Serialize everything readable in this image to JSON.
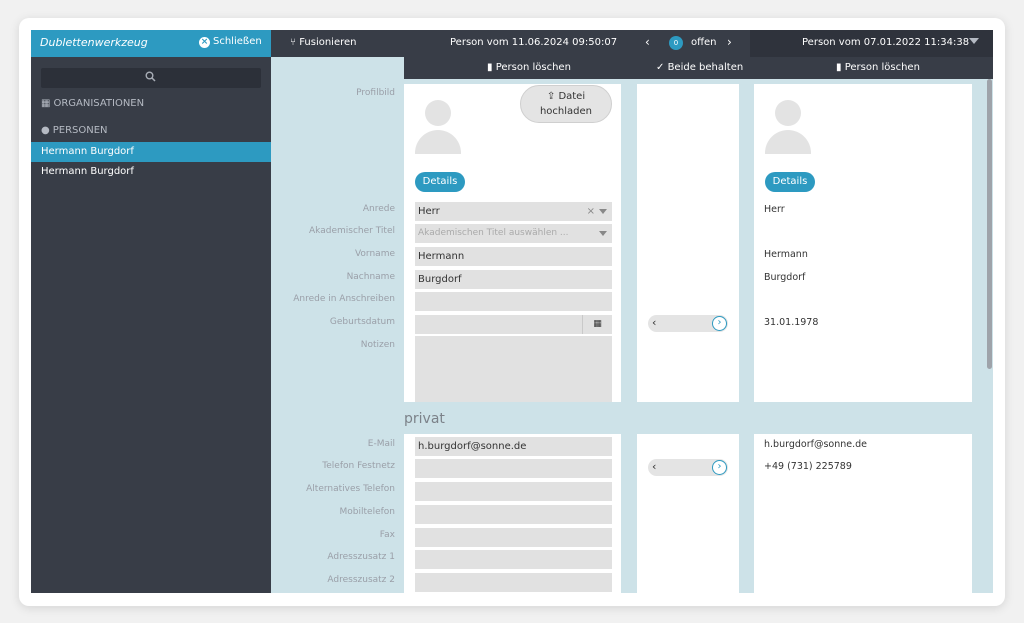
{
  "sidebar": {
    "title": "Dublettenwerkzeug",
    "close_label": "Schließen",
    "search_icon": "search-icon",
    "cat_orgs": "ORGANISATIONEN",
    "cat_persons": "PERSONEN",
    "items": [
      {
        "label": "Hermann Burgdorf",
        "active": true
      },
      {
        "label": "Hermann Burgdorf",
        "active": false
      }
    ]
  },
  "topbar": {
    "merge_label": "Fusionieren",
    "left_record": "Person vom 11.06.2024 09:50:07",
    "open_count": "0",
    "open_label": "offen",
    "right_record": "Person vom 07.01.2022 11:34:38"
  },
  "actions": {
    "delete_left": "Person löschen",
    "keep_both": "Beide behalten",
    "delete_right": "Person löschen"
  },
  "labels": {
    "profilbild": "Profilbild",
    "anrede": "Anrede",
    "titel": "Akademischer Titel",
    "vorname": "Vorname",
    "nachname": "Nachname",
    "anrede_anschreiben": "Anrede in Anschreiben",
    "geburtsdatum": "Geburtsdatum",
    "notizen": "Notizen",
    "privat": "privat",
    "email": "E-Mail",
    "telefon": "Telefon Festnetz",
    "alt_telefon": "Alternatives Telefon",
    "mobil": "Mobiltelefon",
    "fax": "Fax",
    "adresszusatz1": "Adresszusatz 1",
    "adresszusatz2": "Adresszusatz 2"
  },
  "left": {
    "upload_line1": "Datei",
    "upload_line2": "hochladen",
    "details": "Details",
    "anrede": "Herr",
    "titel_placeholder": "Akademischen Titel auswählen ...",
    "vorname": "Hermann",
    "nachname": "Burgdorf",
    "email": "h.burgdorf@sonne.de"
  },
  "right": {
    "details": "Details",
    "anrede": "Herr",
    "vorname": "Hermann",
    "nachname": "Burgdorf",
    "geburtsdatum": "31.01.1978",
    "email": "h.burgdorf@sonne.de",
    "telefon": "+49 (731) 225789"
  },
  "colors": {
    "accent": "#2d9ac1",
    "dark": "#383d47",
    "bg": "#cde2e8"
  }
}
